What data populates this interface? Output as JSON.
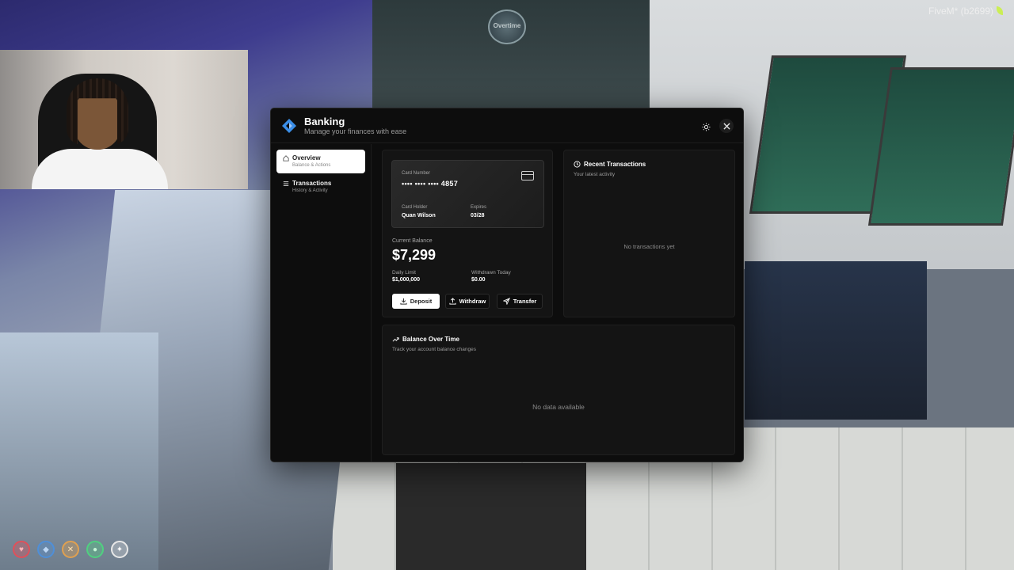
{
  "hud": {
    "client_tag": "FiveM* (b2699)",
    "server_logo_text": "Overtime"
  },
  "banking": {
    "title": "Banking",
    "subtitle": "Manage your finances with ease",
    "sidebar": {
      "items": [
        {
          "label": "Overview",
          "sub": "Balance & Actions",
          "active": true
        },
        {
          "label": "Transactions",
          "sub": "History & Activity",
          "active": false
        }
      ]
    },
    "card": {
      "number_label": "Card Number",
      "number": "•••• •••• •••• 4857",
      "holder_label": "Card Holder",
      "holder": "Quan Wilson",
      "expires_label": "Expires",
      "expires": "03/28"
    },
    "balance": {
      "label": "Current Balance",
      "value": "$7,299"
    },
    "limits": {
      "daily_label": "Daily Limit",
      "daily_value": "$1,000,000",
      "withdrawn_label": "Withdrawn Today",
      "withdrawn_value": "$0.00"
    },
    "actions": {
      "deposit": "Deposit",
      "withdraw": "Withdraw",
      "transfer": "Transfer"
    },
    "recent": {
      "title": "Recent Transactions",
      "subtitle": "Your latest activity",
      "empty": "No transactions yet"
    },
    "chart": {
      "title": "Balance Over Time",
      "subtitle": "Track your account balance changes",
      "empty": "No data available"
    }
  },
  "colors": {
    "modal_bg": "#0d0d0d",
    "panel_bg": "#141414",
    "accent_logo": "#3a8ee8"
  },
  "icons": [
    "logo-icon",
    "sun-icon",
    "close-icon",
    "home-icon",
    "list-icon",
    "credit-card-icon",
    "download-icon",
    "upload-icon",
    "send-icon",
    "clock-icon",
    "trending-up-icon"
  ]
}
